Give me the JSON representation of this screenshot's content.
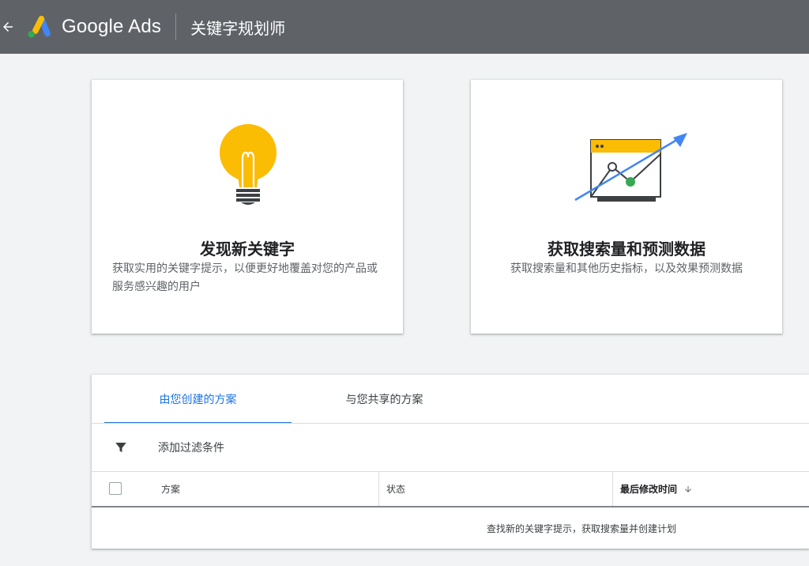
{
  "header": {
    "brand": "Google Ads",
    "tool_title": "关键字规划师"
  },
  "cards": [
    {
      "title": "发现新关键字",
      "description": "获取实用的关键字提示，以便更好地覆盖对您的产品或服务感兴趣的用户"
    },
    {
      "title": "获取搜索量和预测数据",
      "description": "获取搜索量和其他历史指标，以及效果预测数据"
    }
  ],
  "plans": {
    "tabs": [
      {
        "label": "由您创建的方案",
        "active": true
      },
      {
        "label": "与您共享的方案",
        "active": false
      }
    ],
    "filter_label": "添加过滤条件",
    "columns": {
      "plan": "方案",
      "status": "状态",
      "last_modified": "最后修改时间"
    },
    "empty_message": "查找新的关键字提示，获取搜索量并创建计划"
  },
  "colors": {
    "header_bg": "#5f6368",
    "accent": "#1a73e8",
    "bulb_yellow": "#fbbc04",
    "chart_green": "#34a853",
    "arrow_blue": "#4285f4"
  }
}
